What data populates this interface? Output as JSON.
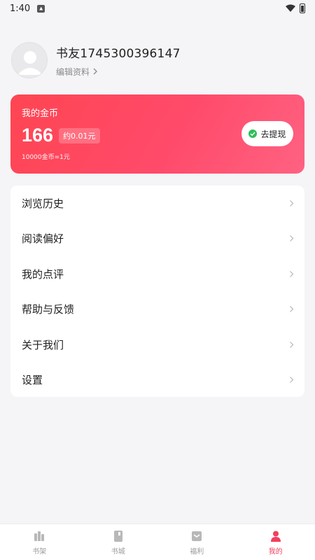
{
  "status_bar": {
    "time": "1:40"
  },
  "profile": {
    "username": "书友1745300396147",
    "edit_label": "编辑资料"
  },
  "coin_card": {
    "title": "我的金币",
    "amount": "166",
    "approx": "约0.01元",
    "rate": "10000金币=1元",
    "withdraw_label": "去提现",
    "colors": {
      "start": "#ff4552",
      "end": "#ff6282"
    }
  },
  "menu": {
    "items": [
      {
        "label": "浏览历史"
      },
      {
        "label": "阅读偏好"
      },
      {
        "label": "我的点评"
      },
      {
        "label": "帮助与反馈"
      },
      {
        "label": "关于我们"
      },
      {
        "label": "设置"
      }
    ]
  },
  "bottom_nav": {
    "items": [
      {
        "label": "书架",
        "icon": "bookshelf-icon"
      },
      {
        "label": "书城",
        "icon": "bookstore-icon"
      },
      {
        "label": "福利",
        "icon": "gift-icon"
      },
      {
        "label": "我的",
        "icon": "person-icon",
        "active": true
      }
    ],
    "active_color": "#f23f5c"
  }
}
